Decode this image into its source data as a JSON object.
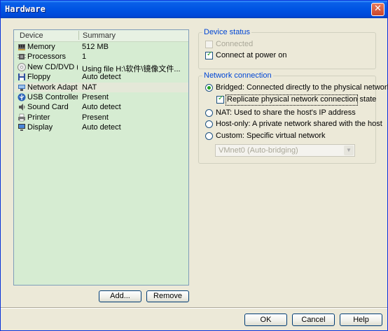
{
  "window": {
    "title": "Hardware",
    "close_glyph": "✕"
  },
  "device_list": {
    "columns": [
      "Device",
      "Summary"
    ],
    "rows": [
      {
        "name": "Memory",
        "summary": "512 MB",
        "icon": "memory-icon"
      },
      {
        "name": "Processors",
        "summary": "1",
        "icon": "processor-icon"
      },
      {
        "name": "New CD/DVD (...",
        "summary": "Using file H:\\软件\\镜像文件...",
        "icon": "cd-dvd-icon"
      },
      {
        "name": "Floppy",
        "summary": "Auto detect",
        "icon": "floppy-icon"
      },
      {
        "name": "Network Adapter",
        "summary": "NAT",
        "icon": "network-adapter-icon",
        "selected": true
      },
      {
        "name": "USB Controller",
        "summary": "Present",
        "icon": "usb-icon"
      },
      {
        "name": "Sound Card",
        "summary": "Auto detect",
        "icon": "sound-card-icon"
      },
      {
        "name": "Printer",
        "summary": "Present",
        "icon": "printer-icon"
      },
      {
        "name": "Display",
        "summary": "Auto detect",
        "icon": "display-icon"
      }
    ],
    "add_button": "Add...",
    "remove_button": "Remove"
  },
  "device_status": {
    "label": "Device status",
    "connected": {
      "label": "Connected",
      "checked": false,
      "disabled": true
    },
    "connect_at_power_on": {
      "label": "Connect at power on",
      "checked": true
    }
  },
  "network_connection": {
    "label": "Network connection",
    "bridged": {
      "label": "Bridged: Connected directly to the physical network",
      "selected": true
    },
    "replicate": {
      "label": "Replicate physical network connection state",
      "checked": true
    },
    "nat": {
      "label": "NAT: Used to share the host's IP address",
      "selected": false
    },
    "host_only": {
      "label": "Host-only: A private network shared with the host",
      "selected": false
    },
    "custom": {
      "label": "Custom: Specific virtual network",
      "selected": false
    },
    "vmnet_select": {
      "value": "VMnet0 (Auto-bridging)",
      "disabled": true
    }
  },
  "footer": {
    "ok": "OK",
    "cancel": "Cancel",
    "help": "Help"
  },
  "colors": {
    "title_bar": "#0054e3",
    "list_background": "#d6ecd2",
    "group_label": "#0046d5",
    "check_mark": "#21a121"
  }
}
